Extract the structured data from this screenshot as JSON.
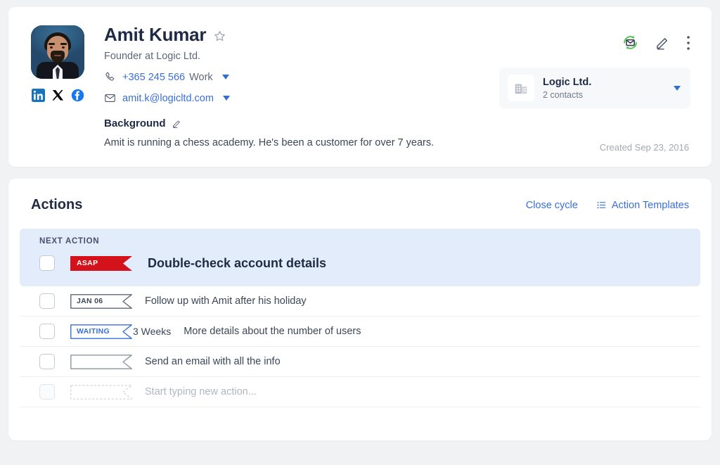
{
  "contact": {
    "name": "Amit Kumar",
    "subtitle": "Founder at Logic Ltd.",
    "phone": "+365 245 566",
    "phone_type": "Work",
    "email": "amit.k@logicltd.com",
    "background_label": "Background",
    "background_text": "Amit is running a chess academy. He's been a customer for over 7 years.",
    "created": "Created Sep 23, 2016",
    "socials": [
      "linkedin-icon",
      "x-icon",
      "facebook-icon"
    ],
    "icons": {
      "favorite": "star-icon",
      "sync_email": "sync-email-icon",
      "edit": "pencil-icon",
      "more": "more-vertical-icon"
    }
  },
  "company": {
    "name": "Logic Ltd.",
    "contacts": "2 contacts",
    "icon": "building-icon"
  },
  "actions": {
    "title": "Actions",
    "close_cycle_label": "Close cycle",
    "templates_label": "Action Templates",
    "next_action_label": "NEXT ACTION",
    "next_action": {
      "tag": "ASAP",
      "title": "Double-check account details",
      "tag_color": "#d4121b",
      "tag_text_color": "#ffffff"
    },
    "items": [
      {
        "tag": "JAN 06",
        "duration": "",
        "title": "Follow up with Amit after his holiday",
        "tag_color": "#5d6878",
        "tag_text_color": "#3b4656",
        "style": "outline"
      },
      {
        "tag": "WAITING",
        "duration": "3 Weeks",
        "title": "More details about the number of users",
        "tag_color": "#3a6fd8",
        "tag_text_color": "#3a6fd8",
        "style": "outline"
      },
      {
        "tag": "",
        "duration": "",
        "title": "Send an email with all the info",
        "tag_color": "#8d95a3",
        "tag_text_color": "#3b4656",
        "style": "outline"
      },
      {
        "tag": "",
        "duration": "",
        "title": "Start typing new action...",
        "tag_color": "#d5d9e0",
        "tag_text_color": "#b0b6c0",
        "style": "dashed"
      }
    ]
  },
  "theme": {
    "page_bg": "#f1f2f4",
    "card_bg": "#ffffff",
    "accent": "#3a6fd8",
    "highlight_bg": "#e3ecfb",
    "text_dark": "#1f2b45"
  }
}
